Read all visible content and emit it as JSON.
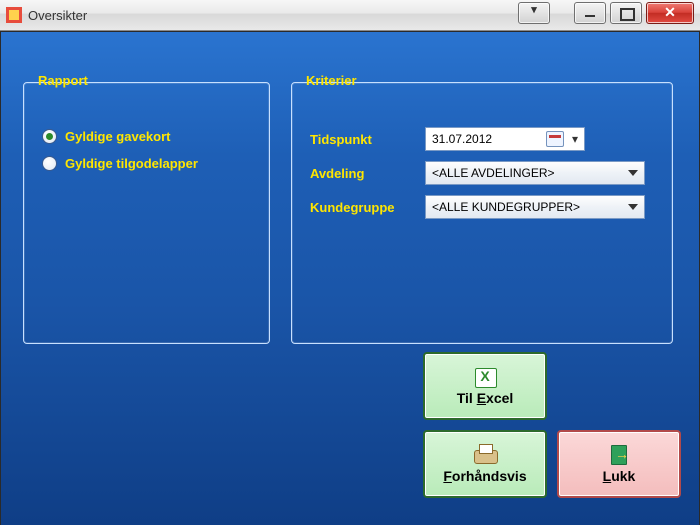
{
  "window": {
    "title": "Oversikter"
  },
  "rapport": {
    "legend": "Rapport",
    "options": [
      {
        "label": "Gyldige gavekort",
        "checked": true
      },
      {
        "label": "Gyldige tilgodelapper",
        "checked": false
      }
    ]
  },
  "kriterier": {
    "legend": "Kriterier",
    "tidspunkt_label": "Tidspunkt",
    "tidspunkt_value": "31.07.2012",
    "avdeling_label": "Avdeling",
    "avdeling_value": "<ALLE AVDELINGER>",
    "kundegruppe_label": "Kundegruppe",
    "kundegruppe_value": "<ALLE KUNDEGRUPPER>"
  },
  "buttons": {
    "excel_prefix": "Til ",
    "excel_u": "E",
    "excel_suffix": "xcel",
    "preview_u": "F",
    "preview_suffix": "orhåndsvis",
    "close_u": "L",
    "close_suffix": "ukk"
  }
}
